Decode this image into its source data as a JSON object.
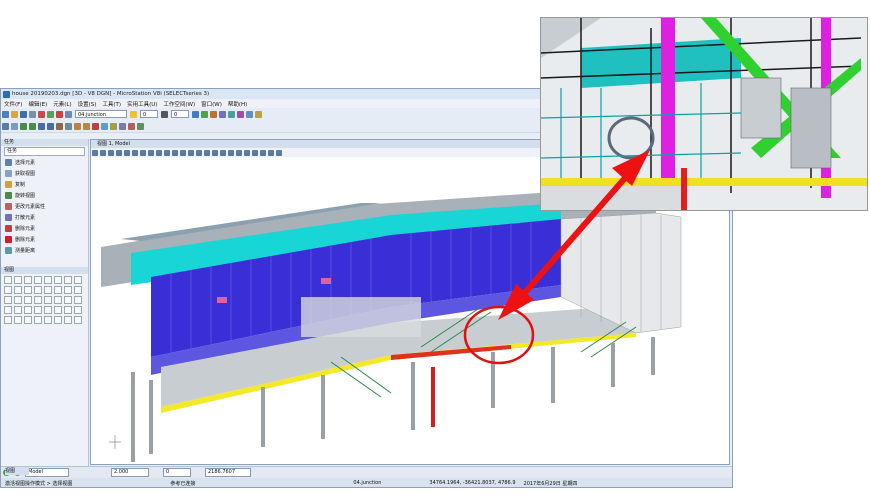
{
  "window": {
    "title": "house 20190203.dgn [3D - V8 DGN] - MicroStation V8i (SELECTseries 3)"
  },
  "menu": [
    "文件(F)",
    "编辑(E)",
    "元素(L)",
    "设置(S)",
    "工具(T)",
    "实用工具(U)",
    "工作空间(W)",
    "窗口(W)",
    "帮助(H)"
  ],
  "toolbar": {
    "level_select": "04.junction",
    "color_value": "0",
    "weight_value": "0"
  },
  "task_panel": {
    "header": "任务",
    "search_label": "任务",
    "items": [
      "选择元素",
      "获取视图",
      "复制",
      "旋转视图",
      "更改元素属性",
      "打散元素",
      "删除元素",
      "删除元素",
      "测量距离"
    ],
    "palette_header": "视图"
  },
  "view": {
    "title": "视图 1, Model"
  },
  "status": {
    "model": "Model",
    "x_value": "2.000",
    "y_value": "0",
    "z_value": "2186.7607",
    "tab_label": "视图",
    "prompt": "激活视图操作模式 > 选择视图",
    "snap_message": "参考已连接",
    "level": "04.junction",
    "coordinates": "34764.1964, -36421.8037, 4786.9",
    "datetime": "2017年6月29日 星期四"
  }
}
